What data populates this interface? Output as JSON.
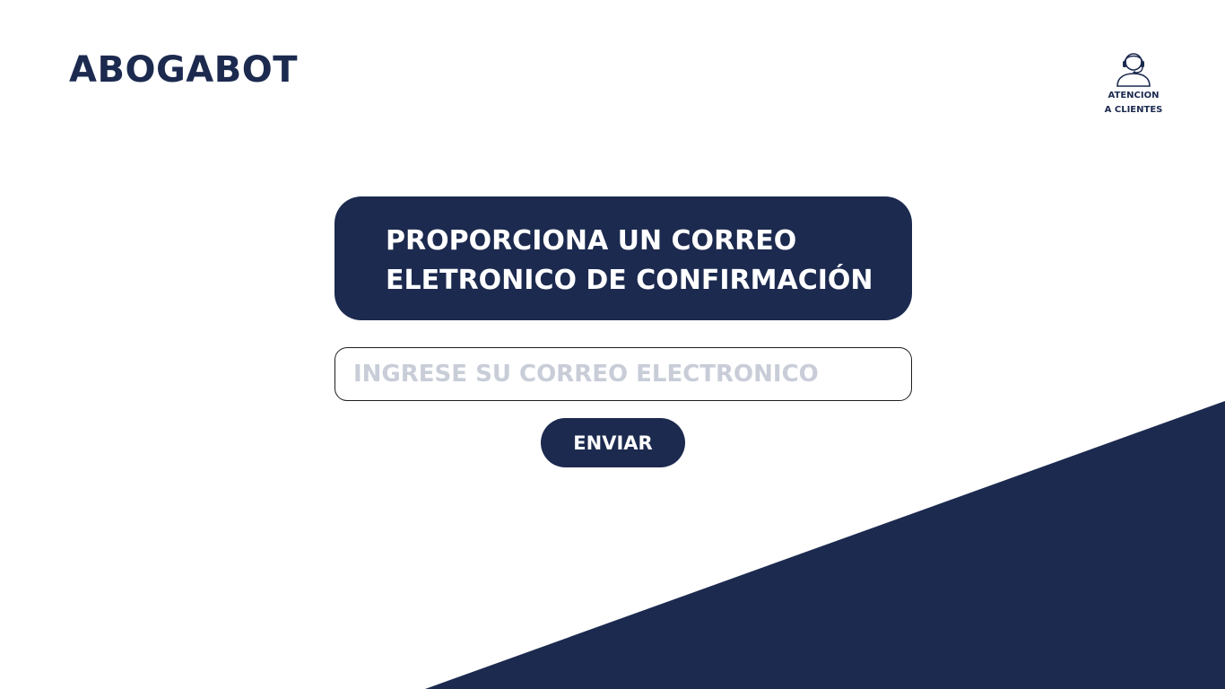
{
  "header": {
    "logo": "ABOGABOT",
    "support": {
      "icon": "headset-agent-icon",
      "label_line1": "ATENCION",
      "label_line2": "A CLIENTES"
    }
  },
  "main": {
    "prompt_line1": "PROPORCIONA UN CORREO",
    "prompt_line2": "ELETRONICO DE CONFIRMACIÓN",
    "email_input": {
      "placeholder": "INGRESE SU CORREO ELECTRONICO",
      "value": ""
    },
    "submit_label": "ENVIAR"
  },
  "colors": {
    "primary": "#1c2a4f",
    "background": "#ffffff",
    "placeholder": "#c8cdd8"
  }
}
